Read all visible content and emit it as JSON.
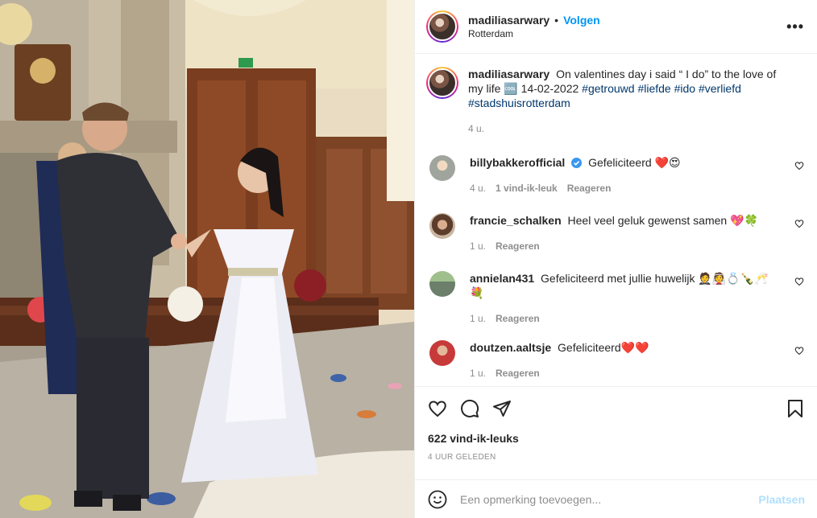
{
  "post": {
    "username": "madiliasarwary",
    "follow_label": "Volgen",
    "location": "Rotterdam",
    "more_icon": "more-options-icon",
    "photo_alt": "photo"
  },
  "caption": {
    "username": "madiliasarwary",
    "text": "On valentines day i said “ I do” to the love of my life 🆒 14-02-2022",
    "hashtags": [
      "#getrouwd",
      "#liefde",
      "#ido",
      "#verliefd",
      "#stadshuisrotterdam"
    ],
    "time": "4 u."
  },
  "comments": [
    {
      "username": "billybakkerofficial",
      "verified": true,
      "text": "Gefeliciteerd ❤️😍",
      "time": "4 u.",
      "likes": "1 vind-ik-leuk",
      "reply": "Reageren"
    },
    {
      "username": "francie_schalken",
      "verified": false,
      "text": "Heel veel geluk gewenst samen 💖🍀",
      "time": "1 u.",
      "likes": "",
      "reply": "Reageren"
    },
    {
      "username": "annielan431",
      "verified": false,
      "text": "Gefeliciteerd met jullie huwelijk 🤵👰💍🍾🥂💐",
      "time": "1 u.",
      "likes": "",
      "reply": "Reageren"
    },
    {
      "username": "doutzen.aaltsje",
      "verified": false,
      "text": "Gefeliciteerd❤️❤️",
      "time": "1 u.",
      "likes": "",
      "reply": "Reageren"
    }
  ],
  "actions": {
    "like_icon": "heart-icon",
    "comment_icon": "comment-icon",
    "share_icon": "share-icon",
    "save_icon": "bookmark-icon",
    "likes_count": "622 vind-ik-leuks",
    "posted_ago": "4 UUR GELEDEN"
  },
  "add_comment": {
    "emoji_icon": "emoji-icon",
    "placeholder": "Een opmerking toevoegen...",
    "post_label": "Plaatsen"
  },
  "colors": {
    "accent": "#0095f6",
    "hashtag": "#00376b",
    "muted": "#8e8e8e",
    "post_disabled": "#b2dffc",
    "verified": "#3897f0"
  }
}
